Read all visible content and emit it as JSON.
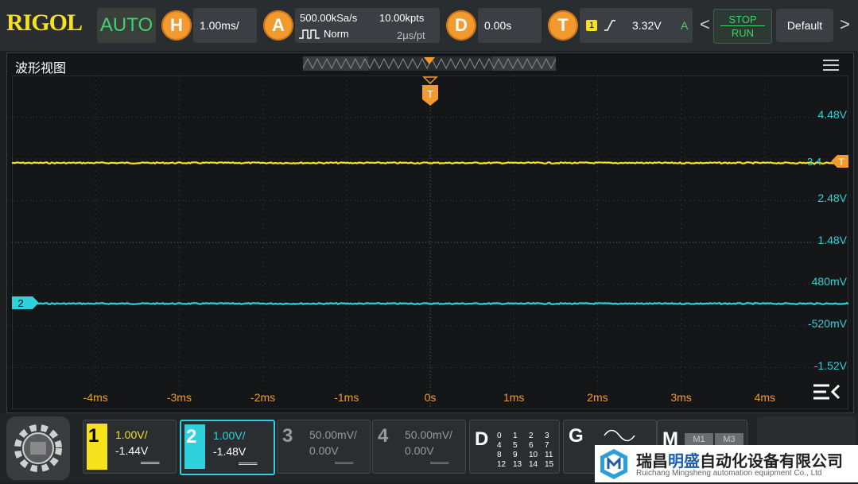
{
  "topbar": {
    "brand": "RIGOL",
    "mode": "AUTO",
    "horizontal": {
      "badge": "H",
      "timebase": "1.00ms/"
    },
    "acquire": {
      "badge": "A",
      "sample_rate": "500.00kSa/s",
      "memory_depth": "10.00kpts",
      "acq_mode": "Norm",
      "time_per_point": "2μs/pt"
    },
    "delay": {
      "badge": "D",
      "value": "0.00s"
    },
    "trigger": {
      "badge": "T",
      "source": "1",
      "level": "3.32V",
      "mode_letter": "A"
    },
    "stop_label": "STOP",
    "run_label": "RUN",
    "default_label": "Default",
    "left_arrow": "<",
    "right_arrow": ">"
  },
  "waveform_view": {
    "title": "波形视图",
    "trigger_marker": "T",
    "trigger_level_marker": "T",
    "trigger_level_text": "3.4",
    "ch2_marker": "2",
    "y_labels": [
      "4.48V",
      "2.48V",
      "1.48V",
      "480mV",
      "-520mV",
      "-1.52V"
    ],
    "x_labels": [
      "-4ms",
      "-3ms",
      "-2ms",
      "-1ms",
      "0s",
      "1ms",
      "2ms",
      "3ms",
      "4ms"
    ]
  },
  "channels": [
    {
      "num": "1",
      "scale": "1.00V/",
      "offset": "-1.44V",
      "coupling": "═══",
      "color": "#f5e11c",
      "active": false,
      "enabled": true
    },
    {
      "num": "2",
      "scale": "1.00V/",
      "offset": "-1.48V",
      "coupling": "═══",
      "color": "#2fd2dc",
      "active": true,
      "enabled": true
    },
    {
      "num": "3",
      "scale": "50.00mV/",
      "offset": "0.00V",
      "coupling": "═══",
      "color": "#9a9a9a",
      "active": false,
      "enabled": false
    },
    {
      "num": "4",
      "scale": "50.00mV/",
      "offset": "0.00V",
      "coupling": "═══",
      "color": "#9a9a9a",
      "active": false,
      "enabled": false
    }
  ],
  "digital": {
    "label": "D",
    "rows": [
      [
        "0",
        "1",
        "2",
        "3"
      ],
      [
        "4",
        "5",
        "6",
        "7"
      ],
      [
        "8",
        "9",
        "10",
        "11"
      ],
      [
        "12",
        "13",
        "14",
        "15"
      ]
    ]
  },
  "generator": {
    "label": "G"
  },
  "math": {
    "label": "M",
    "m1": "M1",
    "m3": "M3"
  },
  "watermark": {
    "company_cn_1": "瑞昌",
    "company_cn_2": "明盛",
    "company_cn_3": "自动化设备有限公司",
    "company_en": "Ruichang Mingsheng automation equipment Co., Ltd"
  },
  "colors": {
    "ch1": "#f5e11c",
    "ch2": "#2fd2dc",
    "accent": "#f29a2e",
    "run": "#3fd36e"
  }
}
